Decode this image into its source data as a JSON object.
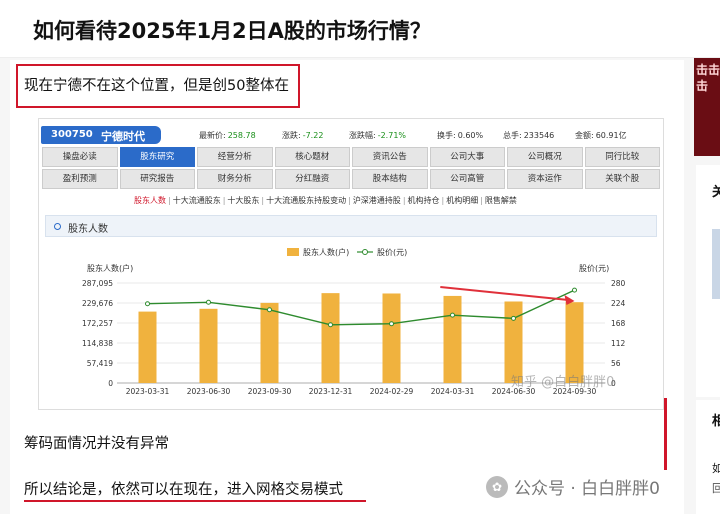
{
  "question": {
    "title": "如何看待2025年1月2日A股的市场行情？"
  },
  "article": {
    "para1": "现在宁德不在这个位置，但是创50整体在",
    "para2": "筹码面情况并没有异常",
    "para3": "所以结论是，依然可以在现在，进入网格交易模式",
    "watermark_bottom": "公众号 · 白白胖胖0",
    "highlight_color": "#d0162a"
  },
  "embedded": {
    "stock_code": "300750",
    "stock_name": "宁德时代",
    "metrics": [
      {
        "label": "最新价:",
        "value": "258.78",
        "color": "#1a8f1a"
      },
      {
        "label": "涨跌:",
        "value": "-7.22",
        "color": "#1a8f1a"
      },
      {
        "label": "涨跌幅:",
        "value": "-2.71%",
        "color": "#1a8f1a"
      },
      {
        "label": "换手:",
        "value": "0.60%",
        "color": "#333333"
      },
      {
        "label": "总手:",
        "value": "233546",
        "color": "#333333"
      },
      {
        "label": "金额:",
        "value": "60.91亿",
        "color": "#333333"
      }
    ],
    "nav_row1": [
      "操盘必读",
      "股东研究",
      "经营分析",
      "核心题材",
      "资讯公告",
      "公司大事",
      "公司概况",
      "同行比较"
    ],
    "nav_row1_active": 1,
    "nav_row2": [
      "盈利预测",
      "研究报告",
      "财务分析",
      "分红融资",
      "股本结构",
      "公司高管",
      "资本运作",
      "关联个股"
    ],
    "sublinks": [
      "股东人数",
      "十大流通股东",
      "十大股东",
      "十大流通股东持股变动",
      "沪深港通持股",
      "机构持仓",
      "机构明细",
      "限售解禁"
    ],
    "panel_title": "股东人数",
    "watermark": "知乎 @白白胖胖0"
  },
  "chart_data": {
    "type": "bar",
    "categories": [
      "2023-03-31",
      "2023-06-30",
      "2023-09-30",
      "2023-12-31",
      "2024-02-29",
      "2024-03-31",
      "2024-06-30",
      "2024-09-30"
    ],
    "series": [
      {
        "name": "股东人数(户)",
        "type": "bar",
        "color": "#f0b23e",
        "values": [
          205000,
          213000,
          230000,
          258000,
          257000,
          250000,
          234000,
          232000
        ]
      },
      {
        "name": "股价(元)",
        "type": "line",
        "color": "#2e8b2e",
        "axis": "right",
        "values": [
          222,
          226,
          205,
          163,
          166,
          190,
          181,
          260
        ]
      }
    ],
    "ylabel": "股东人数(户)",
    "ylabel_right": "股价(元)",
    "yticks": [
      "0",
      "57,419",
      "114,838",
      "172,257",
      "229,676",
      "287,095"
    ],
    "yticks_right": [
      "0",
      "56",
      "112",
      "168",
      "224",
      "280"
    ],
    "ylim": [
      0,
      287095
    ],
    "ylim_right": [
      0,
      280
    ],
    "legend": "top-center",
    "grid": true,
    "annotation": "red arrow"
  },
  "sidebar": {
    "banner_text": "击击击",
    "card1_title": "关",
    "card2_title": "相",
    "card2_line1": "如",
    "card2_line2": "回"
  }
}
